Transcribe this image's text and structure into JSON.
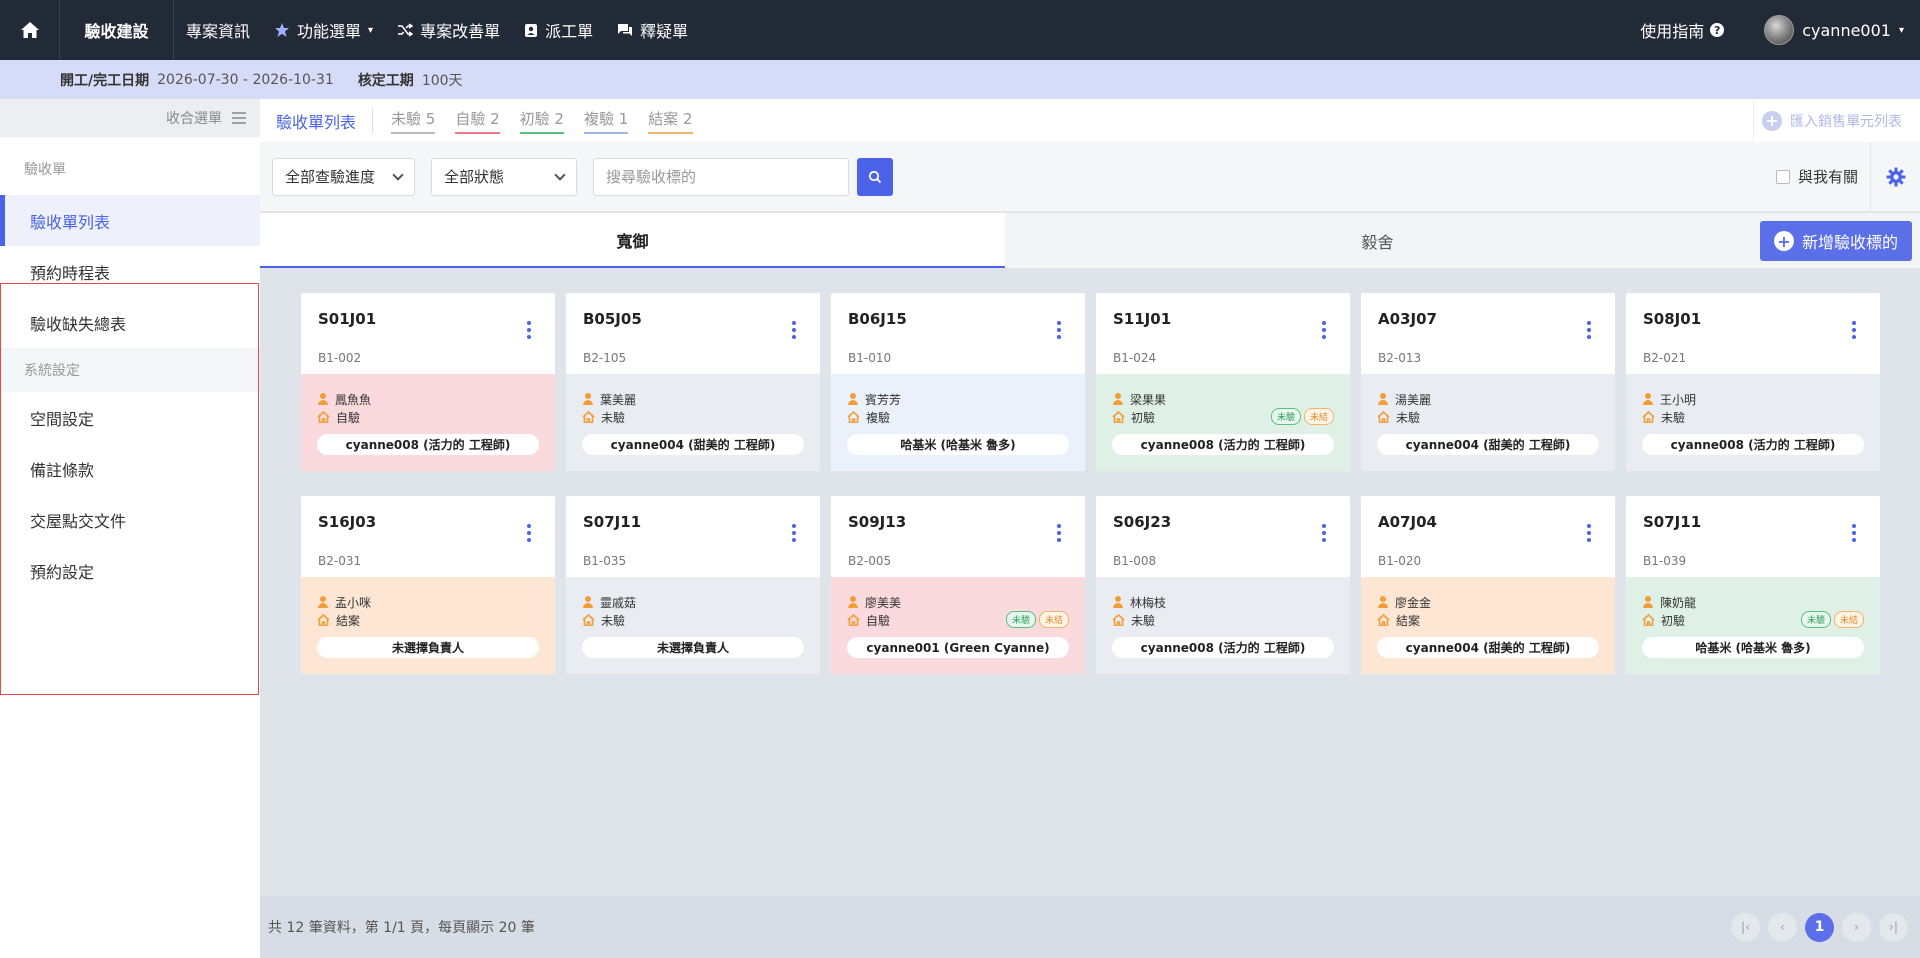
{
  "nav": {
    "brand": "驗收建設",
    "items": [
      {
        "label": "專案資訊",
        "icon": ""
      },
      {
        "label": "功能選單",
        "icon": "star-icon",
        "dropdown": true
      },
      {
        "label": "專案改善單",
        "icon": "shuffle-icon"
      },
      {
        "label": "派工單",
        "icon": "badge-icon"
      },
      {
        "label": "釋疑單",
        "icon": "chat-icon"
      }
    ],
    "guide": "使用指南",
    "username": "cyanne001"
  },
  "info": {
    "date_label": "開工/完工日期",
    "date_value": "2026-07-30 - 2026-10-31",
    "duration_label": "核定工期",
    "duration_value": "100天"
  },
  "sidebar": {
    "collapse_label": "收合選單",
    "group1": "驗收單",
    "group1_items": [
      "驗收單列表",
      "預約時程表",
      "驗收缺失總表"
    ],
    "group2": "系統設定",
    "group2_items": [
      "空間設定",
      "備註條款",
      "交屋點交文件",
      "預約設定"
    ]
  },
  "tabs": {
    "title": "驗收單列表",
    "status_tabs": [
      {
        "label": "未驗 5",
        "color": "#bbbbbb"
      },
      {
        "label": "自驗 2",
        "color": "#f07a8a"
      },
      {
        "label": "初驗 2",
        "color": "#58c27d"
      },
      {
        "label": "複驗 1",
        "color": "#9fb7e8"
      },
      {
        "label": "結案 2",
        "color": "#f2b46a"
      }
    ],
    "import_label": "匯入銷售單元列表"
  },
  "filters": {
    "progress": "全部查驗進度",
    "status": "全部狀態",
    "search_placeholder": "搜尋驗收標的",
    "related_label": "與我有關"
  },
  "buildings": [
    "寬御",
    "毅舍"
  ],
  "add_label": "新增驗收標的",
  "cards": [
    {
      "code": "S01J01",
      "unit": "B1-002",
      "person": "鳳魚魚",
      "stage": "自驗",
      "owner": "cyanne008 (活力的 工程師)",
      "color": "c-red",
      "badges": []
    },
    {
      "code": "B05J05",
      "unit": "B2-105",
      "person": "葉美麗",
      "stage": "未驗",
      "owner": "cyanne004 (甜美的 工程師)",
      "color": "c-gray",
      "badges": []
    },
    {
      "code": "B06J15",
      "unit": "B1-010",
      "person": "賓芳芳",
      "stage": "複驗",
      "owner": "哈基米 (哈基米 魯多)",
      "color": "c-blue",
      "badges": []
    },
    {
      "code": "S11J01",
      "unit": "B1-024",
      "person": "梁果果",
      "stage": "初驗",
      "owner": "cyanne008 (活力的 工程師)",
      "color": "c-green",
      "badges": [
        {
          "t": "未驗",
          "c": "g"
        },
        {
          "t": "未結",
          "c": "o"
        }
      ]
    },
    {
      "code": "A03J07",
      "unit": "B2-013",
      "person": "湯美麗",
      "stage": "未驗",
      "owner": "cyanne004 (甜美的 工程師)",
      "color": "c-gray",
      "badges": []
    },
    {
      "code": "S08J01",
      "unit": "B2-021",
      "person": "王小明",
      "stage": "未驗",
      "owner": "cyanne008 (活力的 工程師)",
      "color": "c-gray",
      "badges": []
    },
    {
      "code": "S16J03",
      "unit": "B2-031",
      "person": "孟小咪",
      "stage": "結案",
      "owner": "未選擇負責人",
      "color": "c-orange",
      "badges": []
    },
    {
      "code": "S07J11",
      "unit": "B1-035",
      "person": "靈戚菇",
      "stage": "未驗",
      "owner": "未選擇負責人",
      "color": "c-gray",
      "badges": []
    },
    {
      "code": "S09J13",
      "unit": "B2-005",
      "person": "廖美美",
      "stage": "自驗",
      "owner": "cyanne001 (Green Cyanne)",
      "color": "c-red",
      "badges": [
        {
          "t": "未驗",
          "c": "g"
        },
        {
          "t": "未結",
          "c": "o"
        }
      ]
    },
    {
      "code": "S06J23",
      "unit": "B1-008",
      "person": "林梅枝",
      "stage": "未驗",
      "owner": "cyanne008 (活力的 工程師)",
      "color": "c-gray",
      "badges": []
    },
    {
      "code": "A07J04",
      "unit": "B1-020",
      "person": "廖金金",
      "stage": "結案",
      "owner": "cyanne004 (甜美的 工程師)",
      "color": "c-orange",
      "badges": []
    },
    {
      "code": "S07J11",
      "unit": "B1-039",
      "person": "陳奶龍",
      "stage": "初驗",
      "owner": "哈基米 (哈基米 魯多)",
      "color": "c-green",
      "badges": [
        {
          "t": "未驗",
          "c": "g"
        },
        {
          "t": "未結",
          "c": "o"
        }
      ]
    }
  ],
  "footer": {
    "summary": "共 12 筆資料，第 1/1 頁，每頁顯示 20 筆",
    "current_page": "1"
  }
}
